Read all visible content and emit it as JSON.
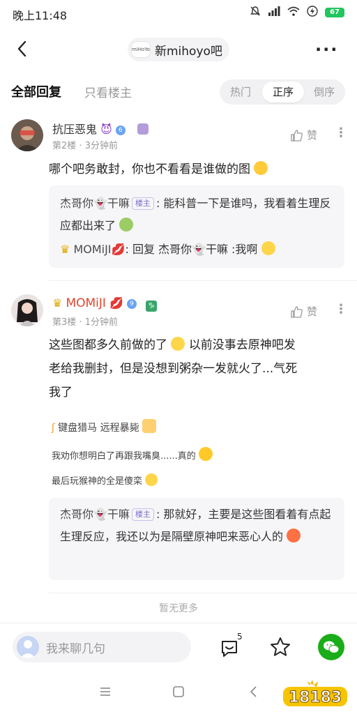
{
  "status": {
    "time": "晚上11:48",
    "battery": "67"
  },
  "header": {
    "logo_text": "miHoYo",
    "title": "新mihoyo吧"
  },
  "filter": {
    "all_label": "全部回复",
    "op_only_label": "只看楼主",
    "sort_options": [
      "热门",
      "正序",
      "倒序"
    ],
    "active_sort": "正序"
  },
  "posts": [
    {
      "username": "抗压恶鬼",
      "level": "6",
      "floor": "第2楼",
      "time": "3分钟前",
      "like_label": "赞",
      "text": "哪个吧务敢封，你也不看看是谁做的图",
      "replies": [
        {
          "name": "杰哥你👻干嘛",
          "tag": "楼主",
          "text": "能科普一下是谁吗，我看着生理反应都出来了"
        },
        {
          "name": "MOMiJI💋",
          "text": "回复 杰哥你👻干嘛 :我啊"
        }
      ]
    },
    {
      "username": "MOMiJI",
      "level": "9",
      "floor": "第3楼",
      "time": "1分钟前",
      "like_label": "赞",
      "text_lines": [
        "这些图都多久前做的了",
        "以前没事去原神吧发",
        "老给我删封，但是没想到粥杂一发就火了...气死",
        "我了"
      ],
      "signature": [
        "键盘猎马 远程暴毙",
        "我劝你想明白了再跟我嘴臭......真的",
        "最后玩猴神的全是傻栾"
      ],
      "replies": [
        {
          "name": "杰哥你👻干嘛",
          "tag": "楼主",
          "text": "那就好，主要是这些图看着有点起生理反应，我还以为是隔壁原神吧来恶心人的"
        }
      ]
    }
  ],
  "footer": {
    "no_more": "暂无更多",
    "reply_placeholder": "我来聊几句",
    "comment_count": "5",
    "watermark": "18183"
  }
}
